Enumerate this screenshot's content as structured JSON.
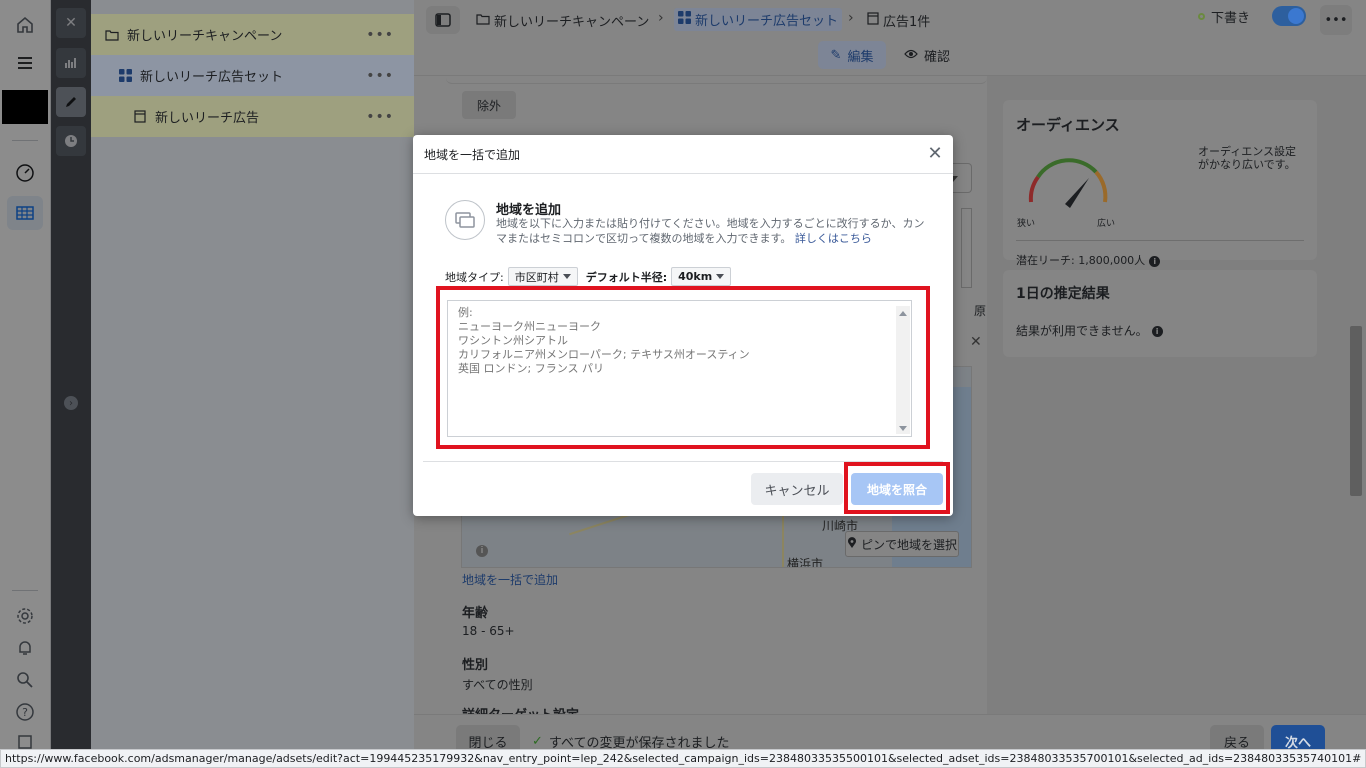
{
  "tree": {
    "campaign": "新しいリーチキャンペーン",
    "adset": "新しいリーチ広告セット",
    "ad": "新しいリーチ広告"
  },
  "topbar": {
    "crumb_campaign": "新しいリーチキャンペーン",
    "crumb_adset": "新しいリーチ広告セット",
    "crumb_ad": "広告1件",
    "draft": "下書き",
    "edit_tab": "編集",
    "review_tab": "確認"
  },
  "form": {
    "exclude": "除外",
    "map_label_kawasaki": "川崎市",
    "map_label_yokohama": "横浜市",
    "pin_button": "ピンで地域を選択",
    "bulk_link": "地域を一括で追加",
    "age_label": "年齢",
    "age_value": "18 - 65+",
    "gender_label": "性別",
    "gender_value": "すべての性別",
    "detail_label": "詳細ターゲット設定",
    "partial_label": "原"
  },
  "audience": {
    "title": "オーディエンス",
    "note": "オーディエンス設定がかなり広いです。",
    "narrow": "狭い",
    "wide": "広い",
    "reach": "潜在リーチ: 1,800,000人"
  },
  "estimate": {
    "title": "1日の推定結果",
    "note": "結果が利用できません。"
  },
  "bottom": {
    "close": "閉じる",
    "saved": "すべての変更が保存されました",
    "back": "戻る",
    "next": "次へ"
  },
  "modal": {
    "title": "地域を一括で追加",
    "heading": "地域を追加",
    "desc": "地域を以下に入力または貼り付けてください。地域を入力するごとに改行するか、カンマまたはセミコロンで区切って複数の地域を入力できます。",
    "learn_more": "詳しくはこちら",
    "type_label": "地域タイプ:",
    "type_value": "市区町村",
    "radius_label": "デフォルト半径:",
    "radius_value": "40km",
    "placeholder": "例:\nニューヨーク州ニューヨーク\nワシントン州シアトル\nカリフォルニア州メンローパーク; テキサス州オースティン\n英国 ロンドン; フランス パリ",
    "cancel": "キャンセル",
    "merge": "地域を照合"
  },
  "statusbar": {
    "url": "https://www.facebook.com/adsmanager/manage/adsets/edit?act=199445235179932&nav_entry_point=lep_242&selected_campaign_ids=23848033535500101&selected_adset_ids=23848033535700101&selected_ad_ids=23848033535740101#"
  },
  "colors": {
    "accent": "#1877f2",
    "highlight_red": "#e0131f",
    "merge_disabled": "#a7c6f5"
  }
}
